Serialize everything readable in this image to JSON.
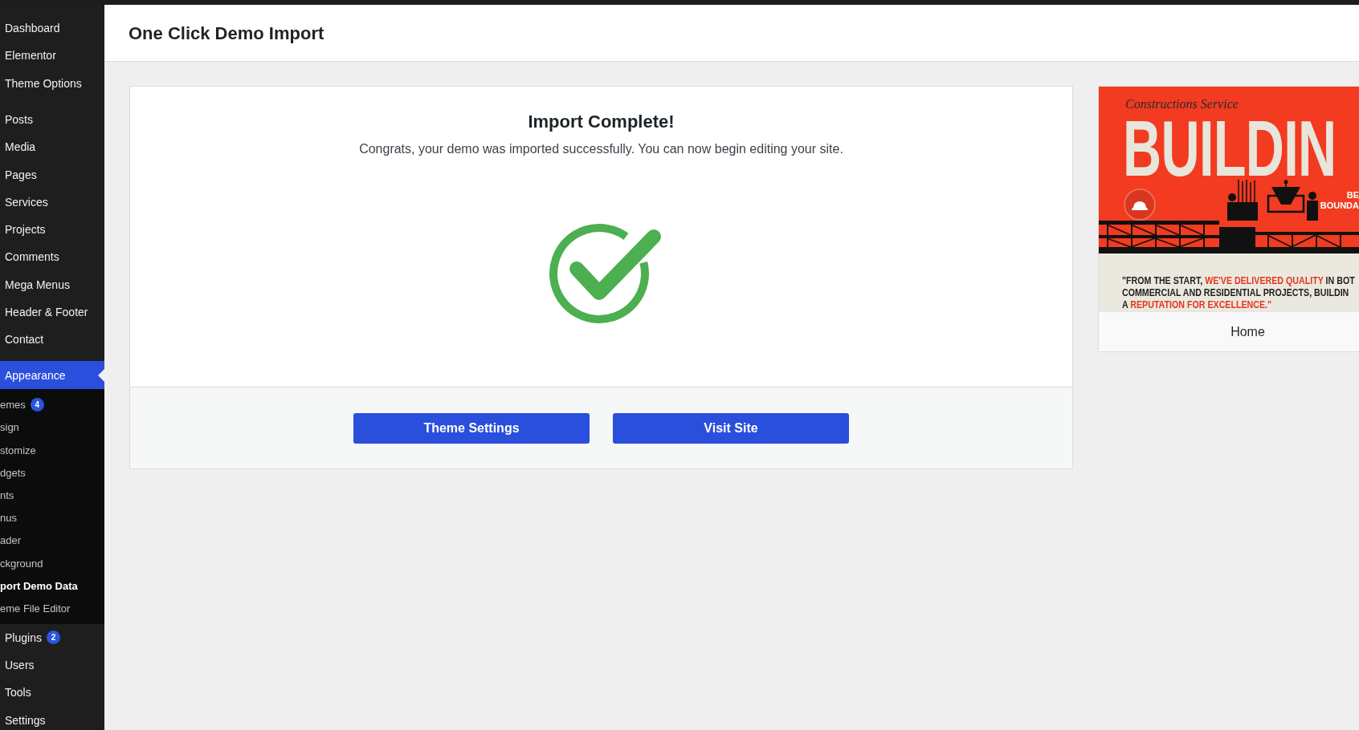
{
  "sidebar": {
    "groups": [
      [
        {
          "label": "Dashboard",
          "selected": false
        },
        {
          "label": "Elementor",
          "selected": false
        },
        {
          "label": "Theme Options",
          "selected": false
        }
      ],
      [
        {
          "label": "Posts",
          "selected": false
        },
        {
          "label": "Media",
          "selected": false
        },
        {
          "label": "Pages",
          "selected": false
        },
        {
          "label": "Services",
          "selected": false
        },
        {
          "label": "Projects",
          "selected": false
        },
        {
          "label": "Comments",
          "selected": false
        },
        {
          "label": "Mega Menus",
          "selected": false
        },
        {
          "label": "Header & Footer",
          "selected": false
        },
        {
          "label": "Contact",
          "selected": false
        }
      ],
      [
        {
          "label": "Appearance",
          "selected": true,
          "children": [
            {
              "label": "emes",
              "selected": false,
              "badge": "4"
            },
            {
              "label": "sign",
              "selected": false
            },
            {
              "label": "stomize",
              "selected": false
            },
            {
              "label": "dgets",
              "selected": false
            },
            {
              "label": "nts",
              "selected": false
            },
            {
              "label": "nus",
              "selected": false
            },
            {
              "label": "ader",
              "selected": false
            },
            {
              "label": "ckground",
              "selected": false
            },
            {
              "label": "port Demo Data",
              "selected": true
            },
            {
              "label": "eme File Editor",
              "selected": false
            }
          ]
        },
        {
          "label": "Plugins",
          "selected": false,
          "badge": "2"
        },
        {
          "label": "Users",
          "selected": false
        },
        {
          "label": "Tools",
          "selected": false
        },
        {
          "label": "Settings",
          "selected": false
        }
      ]
    ]
  },
  "page_header": {
    "title": "One Click Demo Import"
  },
  "import_result": {
    "success": true,
    "title": "Import Complete!",
    "message": "Congrats, your demo was imported successfully. You can now begin editing your site.",
    "buttons": [
      {
        "label": "Theme Settings"
      },
      {
        "label": "Visit Site"
      }
    ]
  },
  "demo_preview": {
    "name": "Home",
    "screenshot": {
      "headline": "BUILDIN",
      "script_text": "Constructions Service",
      "side_heading": [
        "BE",
        "BOUNDA"
      ],
      "quote": [
        [
          {
            "text": "\"FROM THE START, ",
            "highlight": false
          },
          {
            "text": "WE'VE DELIVERED QUALITY",
            "highlight": true
          },
          {
            "text": " IN BOT",
            "highlight": false
          }
        ],
        [
          {
            "text": "COMMERCIAL AND RESIDENTIAL PROJECTS, BUILDIN",
            "highlight": false
          }
        ],
        [
          {
            "text": "A ",
            "highlight": false
          },
          {
            "text": "REPUTATION FOR EXCELLENCE.\"",
            "highlight": true
          }
        ]
      ]
    }
  }
}
